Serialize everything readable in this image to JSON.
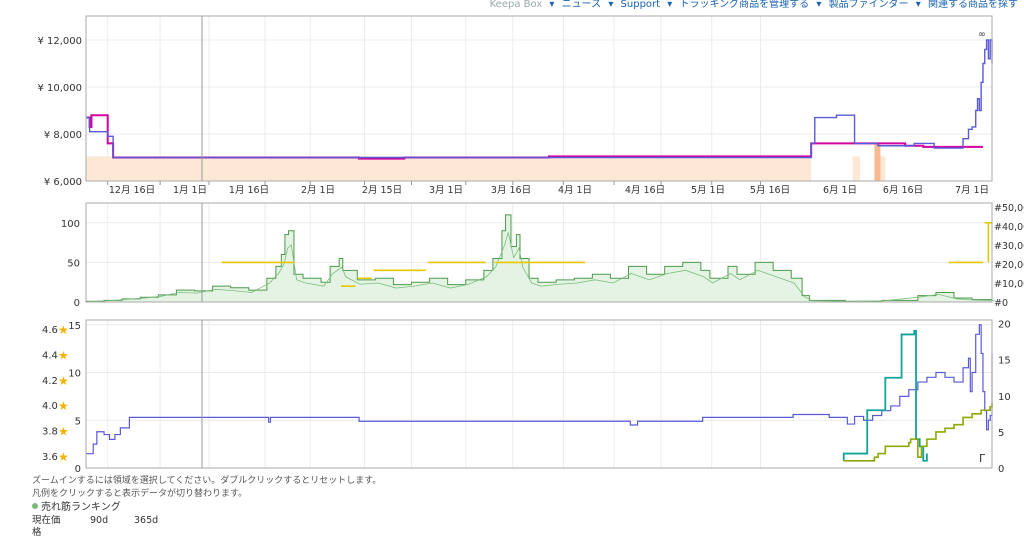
{
  "nav": {
    "items": [
      "Keepa Box",
      "ニュース",
      "Support",
      "トラッキング商品を管理する",
      "製品ファインダー",
      "関連する商品を探す"
    ]
  },
  "colors": {
    "amazon": "#f2a04c",
    "new": "#5a5ad8",
    "new3p": "#d400a0",
    "rank": "#4c9a4c",
    "rankFill": "#e4f3e4",
    "offer": "#e6c800",
    "rating": "#8fa800",
    "reviews": "#12a39a",
    "grid": "#ececec"
  },
  "chart_data": [
    {
      "type": "line",
      "panel": "price",
      "y_tick_labels": [
        "¥ 6,000",
        "¥ 8,000",
        "¥ 10,000",
        "¥ 12,000"
      ],
      "ylim": [
        6000,
        12000
      ],
      "x_tick_labels": [
        "12月 16日",
        "1月 1日",
        "1月 16日",
        "2月 1日",
        "2月 15日",
        "3月 1日",
        "3月 16日",
        "4月 1日",
        "4月 16日",
        "5月 1日",
        "5月 16日",
        "6月 1日",
        "6月 16日",
        "7月 1日"
      ],
      "series": [
        {
          "key": "new3p",
          "values": [
            [
              0,
              8700
            ],
            [
              1,
              8700
            ],
            [
              2,
              8300
            ],
            [
              3,
              8800
            ],
            [
              11,
              8800
            ],
            [
              12,
              7600
            ],
            [
              14,
              7600
            ],
            [
              15,
              7000
            ],
            [
              150,
              7000
            ],
            [
              151,
              6950
            ],
            [
              175,
              6950
            ],
            [
              176,
              7000
            ],
            [
              255,
              7000
            ],
            [
              256,
              7050
            ],
            [
              400,
              7050
            ],
            [
              401,
              7600
            ],
            [
              413,
              7600
            ],
            [
              452,
              7600
            ],
            [
              453,
              7500
            ],
            [
              462,
              7500
            ],
            [
              463,
              7450
            ],
            [
              495,
              7450
            ],
            [
              496,
              7450
            ]
          ]
        },
        {
          "key": "new",
          "values": [
            [
              0,
              8700
            ],
            [
              2,
              8100
            ],
            [
              10,
              8100
            ],
            [
              12,
              7900
            ],
            [
              15,
              7000
            ],
            [
              400,
              7000
            ],
            [
              401,
              7600
            ],
            [
              403,
              8700
            ],
            [
              415,
              8800
            ],
            [
              424,
              8800
            ],
            [
              425,
              7600
            ],
            [
              437,
              7600
            ],
            [
              438,
              7500
            ],
            [
              457,
              7500
            ],
            [
              458,
              7600
            ],
            [
              468,
              7600
            ],
            [
              469,
              7400
            ],
            [
              482,
              7400
            ],
            [
              485,
              7800
            ],
            [
              488,
              8200
            ],
            [
              490,
              8300
            ],
            [
              492,
              9000
            ],
            [
              493,
              9500
            ],
            [
              494,
              9000
            ],
            [
              495,
              10200
            ],
            [
              496,
              11000
            ],
            [
              497,
              11600
            ],
            [
              498,
              12000
            ],
            [
              499,
              11200
            ],
            [
              500,
              12000
            ],
            [
              501,
              11000
            ]
          ]
        }
      ],
      "amazon_area": [
        [
          0,
          401
        ],
        [
          424,
          428
        ],
        [
          436,
          442
        ]
      ]
    },
    {
      "type": "area",
      "panel": "sales-rank",
      "y_tick_labels": [
        "0",
        "50",
        "100"
      ],
      "y2_tick_labels": [
        "#0",
        "#10,000",
        "#20,000",
        "#30,000",
        "#40,000",
        "#50,000"
      ],
      "ylim": [
        0,
        125
      ],
      "y2lim": [
        0,
        50000
      ],
      "offer_count_segments": [
        [
          75,
          115,
          50
        ],
        [
          141,
          149,
          20
        ],
        [
          150,
          158,
          30
        ],
        [
          159,
          188,
          40
        ],
        [
          189,
          221,
          50
        ],
        [
          226,
          276,
          50
        ],
        [
          477,
          496,
          50
        ],
        [
          497,
          501,
          100
        ]
      ],
      "rank_peaks": [
        [
          0,
          1
        ],
        [
          10,
          2
        ],
        [
          20,
          4
        ],
        [
          30,
          6
        ],
        [
          40,
          9
        ],
        [
          50,
          15
        ],
        [
          60,
          14
        ],
        [
          70,
          20
        ],
        [
          80,
          18
        ],
        [
          90,
          15
        ],
        [
          100,
          30
        ],
        [
          105,
          45
        ],
        [
          108,
          60
        ],
        [
          110,
          85
        ],
        [
          112,
          90
        ],
        [
          115,
          35
        ],
        [
          120,
          30
        ],
        [
          130,
          25
        ],
        [
          135,
          45
        ],
        [
          140,
          55
        ],
        [
          142,
          40
        ],
        [
          150,
          28
        ],
        [
          160,
          30
        ],
        [
          170,
          22
        ],
        [
          180,
          25
        ],
        [
          190,
          30
        ],
        [
          200,
          22
        ],
        [
          210,
          28
        ],
        [
          220,
          40
        ],
        [
          225,
          55
        ],
        [
          230,
          90
        ],
        [
          232,
          110
        ],
        [
          235,
          70
        ],
        [
          238,
          85
        ],
        [
          240,
          55
        ],
        [
          245,
          30
        ],
        [
          250,
          25
        ],
        [
          260,
          28
        ],
        [
          270,
          30
        ],
        [
          280,
          35
        ],
        [
          290,
          30
        ],
        [
          300,
          45
        ],
        [
          310,
          35
        ],
        [
          320,
          45
        ],
        [
          330,
          50
        ],
        [
          340,
          40
        ],
        [
          345,
          30
        ],
        [
          355,
          45
        ],
        [
          360,
          35
        ],
        [
          370,
          50
        ],
        [
          380,
          40
        ],
        [
          390,
          30
        ],
        [
          396,
          8
        ],
        [
          400,
          2
        ],
        [
          420,
          1
        ],
        [
          440,
          2
        ],
        [
          460,
          8
        ],
        [
          470,
          12
        ],
        [
          480,
          5
        ],
        [
          490,
          3
        ],
        [
          501,
          2
        ]
      ]
    },
    {
      "type": "line",
      "panel": "rating-reviews",
      "rating_tick_labels": [
        "3.6",
        "3.8",
        "4.0",
        "4.2",
        "4.4",
        "4.6"
      ],
      "ratings": [
        3.6,
        3.8,
        4.0,
        4.2,
        4.4,
        4.6
      ],
      "y_tick_labels": [
        "0",
        "5",
        "10",
        "15"
      ],
      "ylim": [
        0,
        15.5
      ],
      "y2_tick_labels": [
        "0",
        "5",
        "10",
        "15",
        "20"
      ],
      "y2lim": [
        0,
        20.5
      ],
      "y_right_extra_label": "Γ",
      "series": [
        {
          "key": "new",
          "values": [
            [
              0,
              1.5
            ],
            [
              3,
              1.5
            ],
            [
              4,
              2.5
            ],
            [
              6,
              3.8
            ],
            [
              9,
              3.8
            ],
            [
              10,
              3.5
            ],
            [
              12,
              3.5
            ],
            [
              13,
              3.0
            ],
            [
              15,
              3.0
            ],
            [
              16,
              3.5
            ],
            [
              18,
              3.5
            ],
            [
              19,
              4.2
            ],
            [
              23,
              4.2
            ],
            [
              24,
              5.3
            ],
            [
              100,
              5.3
            ],
            [
              101,
              4.8
            ],
            [
              102,
              5.3
            ],
            [
              150,
              5.3
            ],
            [
              151,
              4.9
            ],
            [
              300,
              4.9
            ],
            [
              301,
              4.5
            ],
            [
              304,
              4.5
            ],
            [
              305,
              4.9
            ],
            [
              340,
              4.9
            ],
            [
              341,
              5.3
            ],
            [
              390,
              5.3
            ],
            [
              391,
              5.6
            ],
            [
              410,
              5.6
            ],
            [
              411,
              5.3
            ],
            [
              420,
              5.3
            ],
            [
              421,
              4.6
            ],
            [
              425,
              5.4
            ],
            [
              430,
              5.0
            ],
            [
              435,
              5.5
            ],
            [
              440,
              6.0
            ],
            [
              445,
              6.5
            ],
            [
              450,
              7.5
            ],
            [
              455,
              8.2
            ],
            [
              460,
              9.0
            ],
            [
              465,
              9.5
            ],
            [
              470,
              10.0
            ],
            [
              475,
              9.5
            ],
            [
              480,
              9.0
            ],
            [
              485,
              10.5
            ],
            [
              488,
              11.5
            ],
            [
              489,
              8.0
            ],
            [
              490,
              10.0
            ],
            [
              492,
              14.0
            ],
            [
              494,
              15.0
            ],
            [
              495,
              12.0
            ],
            [
              496,
              8.0
            ],
            [
              497,
              6.0
            ],
            [
              498,
              4.0
            ],
            [
              499,
              5.0
            ],
            [
              500,
              5.5
            ],
            [
              501,
              12.0
            ]
          ]
        },
        {
          "key": "reviews",
          "values": [
            [
              419,
              1
            ],
            [
              419,
              2
            ],
            [
              432,
              2
            ],
            [
              432,
              8
            ],
            [
              442,
              8
            ],
            [
              442,
              12.5
            ],
            [
              451,
              12.5
            ],
            [
              451,
              18.5
            ],
            [
              458,
              18.5
            ],
            [
              458,
              19
            ],
            [
              459,
              19
            ],
            [
              459,
              4
            ],
            [
              461,
              4
            ],
            [
              461,
              3
            ],
            [
              463,
              3
            ],
            [
              463,
              1
            ],
            [
              465,
              1
            ],
            [
              465,
              2
            ]
          ]
        },
        {
          "key": "rating",
          "values": [
            [
              419,
              1
            ],
            [
              435,
              1
            ],
            [
              436,
              1.5
            ],
            [
              438,
              2
            ],
            [
              442,
              3
            ],
            [
              455,
              3.5
            ],
            [
              456,
              4.0
            ],
            [
              459,
              4.0
            ],
            [
              460,
              1.5
            ],
            [
              462,
              3
            ],
            [
              465,
              4
            ],
            [
              470,
              5
            ],
            [
              475,
              5.5
            ],
            [
              480,
              6.0
            ],
            [
              485,
              7.0
            ],
            [
              490,
              7.5
            ],
            [
              495,
              8.0
            ],
            [
              500,
              8.5
            ],
            [
              501,
              9.0
            ]
          ]
        }
      ]
    }
  ],
  "footer": {
    "hint1": "ズームインするには領域を選択してください。ダブルクリックするとリセットします。",
    "hint2": "凡例をクリックすると表示データが切り替わります。",
    "legend_rank": "売れ筋ランキング",
    "col_current": "現在価",
    "col_90d": "90d",
    "col_365d": "365d",
    "price_label": "格"
  }
}
